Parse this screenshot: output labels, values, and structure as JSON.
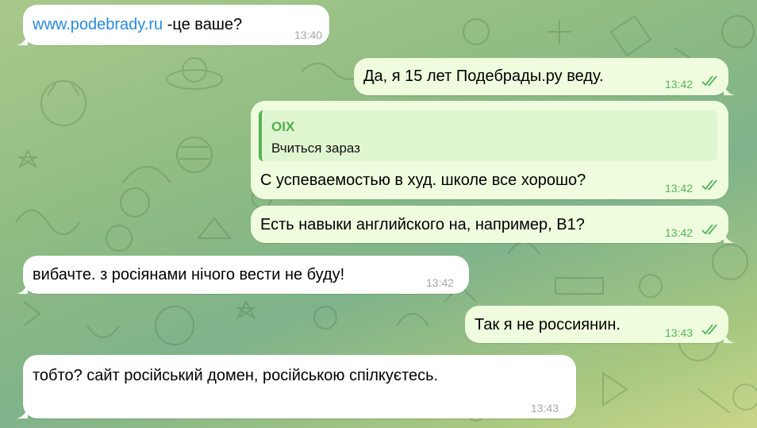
{
  "colors": {
    "incoming_bg": "#ffffff",
    "outgoing_bg": "#effdde",
    "link": "#2a8ad8",
    "time_out": "#52b35c",
    "time_in": "#a7a7a7",
    "reply_accent": "#56b356"
  },
  "messages": [
    {
      "direction": "in",
      "link": "www.podebrady.ru",
      "text": " -це ваше?",
      "time": "13:40"
    },
    {
      "direction": "out",
      "text": "Да, я 15 лет Подебрады.ру веду.",
      "time": "13:42",
      "status_icon": "double-check-icon"
    },
    {
      "direction": "out",
      "reply_to": {
        "name": "OIX",
        "text": "Вчиться зараз"
      },
      "text": "С успеваемостью в худ. школе все хорошо?",
      "time": "13:42",
      "status_icon": "double-check-icon"
    },
    {
      "direction": "out",
      "text": "Есть навыки английского на, например, B1?",
      "time": "13:42",
      "status_icon": "double-check-icon"
    },
    {
      "direction": "in",
      "text": "вибачте. з росіянами нічого вести не буду!",
      "time": "13:42"
    },
    {
      "direction": "out",
      "text": "Так я не россиянин.",
      "time": "13:43",
      "status_icon": "double-check-icon"
    },
    {
      "direction": "in",
      "text": "тобто? сайт російський домен, російською спілкуєтесь.",
      "time": "13:43"
    }
  ]
}
